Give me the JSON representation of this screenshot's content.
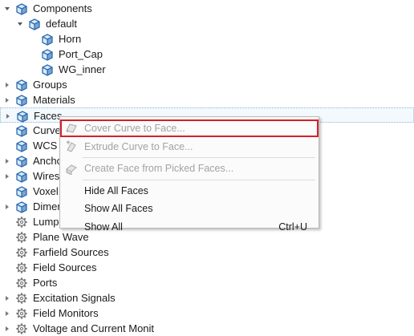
{
  "tree": {
    "items": [
      {
        "label": "Components",
        "level": 0,
        "toggle": "expanded",
        "icon": "cube-icon"
      },
      {
        "label": "default",
        "level": 1,
        "toggle": "expanded",
        "icon": "cube-icon"
      },
      {
        "label": "Horn",
        "level": 2,
        "toggle": "none",
        "icon": "cube-icon"
      },
      {
        "label": "Port_Cap",
        "level": 2,
        "toggle": "none",
        "icon": "cube-icon"
      },
      {
        "label": "WG_inner",
        "level": 2,
        "toggle": "none",
        "icon": "cube-icon"
      },
      {
        "label": "Groups",
        "level": 0,
        "toggle": "collapsed",
        "icon": "cube-icon"
      },
      {
        "label": "Materials",
        "level": 0,
        "toggle": "collapsed",
        "icon": "cube-icon"
      },
      {
        "label": "Faces",
        "level": 0,
        "toggle": "collapsed",
        "icon": "cube-icon",
        "selected": true
      },
      {
        "label": "Curve",
        "level": 0,
        "toggle": "none",
        "icon": "cube-icon"
      },
      {
        "label": "WCS",
        "level": 0,
        "toggle": "none",
        "icon": "cube-icon"
      },
      {
        "label": "Ancho",
        "level": 0,
        "toggle": "collapsed",
        "icon": "cube-icon"
      },
      {
        "label": "Wires",
        "level": 0,
        "toggle": "collapsed",
        "icon": "cube-icon"
      },
      {
        "label": "Voxel",
        "level": 0,
        "toggle": "none",
        "icon": "cube-icon"
      },
      {
        "label": "Dimer",
        "level": 0,
        "toggle": "collapsed",
        "icon": "cube-icon"
      },
      {
        "label": "Lumpe",
        "level": 0,
        "toggle": "none",
        "icon": "gear-icon"
      },
      {
        "label": "Plane Wave",
        "level": 0,
        "toggle": "none",
        "icon": "gear-icon"
      },
      {
        "label": "Farfield Sources",
        "level": 0,
        "toggle": "none",
        "icon": "gear-icon"
      },
      {
        "label": "Field Sources",
        "level": 0,
        "toggle": "none",
        "icon": "gear-icon"
      },
      {
        "label": "Ports",
        "level": 0,
        "toggle": "none",
        "icon": "gear-icon"
      },
      {
        "label": "Excitation Signals",
        "level": 0,
        "toggle": "collapsed",
        "icon": "gear-icon"
      },
      {
        "label": "Field Monitors",
        "level": 0,
        "toggle": "collapsed",
        "icon": "gear-icon"
      },
      {
        "label": "Voltage and Current Monit",
        "level": 0,
        "toggle": "collapsed",
        "icon": "gear-icon"
      }
    ]
  },
  "context_menu": {
    "items": [
      {
        "label": "Cover Curve to Face...",
        "enabled": false,
        "highlighted": true,
        "icon": "cover-face-icon",
        "shortcut": ""
      },
      {
        "label": "Extrude Curve to Face...",
        "enabled": false,
        "icon": "extrude-face-icon",
        "shortcut": ""
      },
      {
        "separator": true
      },
      {
        "label": "Create Face from Picked Faces...",
        "enabled": false,
        "icon": "create-face-icon",
        "shortcut": ""
      },
      {
        "separator": true
      },
      {
        "label": "Hide All Faces",
        "enabled": true,
        "shortcut": ""
      },
      {
        "label": "Show All Faces",
        "enabled": true,
        "shortcut": ""
      },
      {
        "label": "Show All",
        "enabled": true,
        "shortcut": "Ctrl+U"
      }
    ]
  },
  "colors": {
    "cube_icon": "#2b6cb0",
    "gear_icon": "#777777",
    "highlight_border": "#d5202a",
    "selection_bg": "#f3f9fd"
  }
}
